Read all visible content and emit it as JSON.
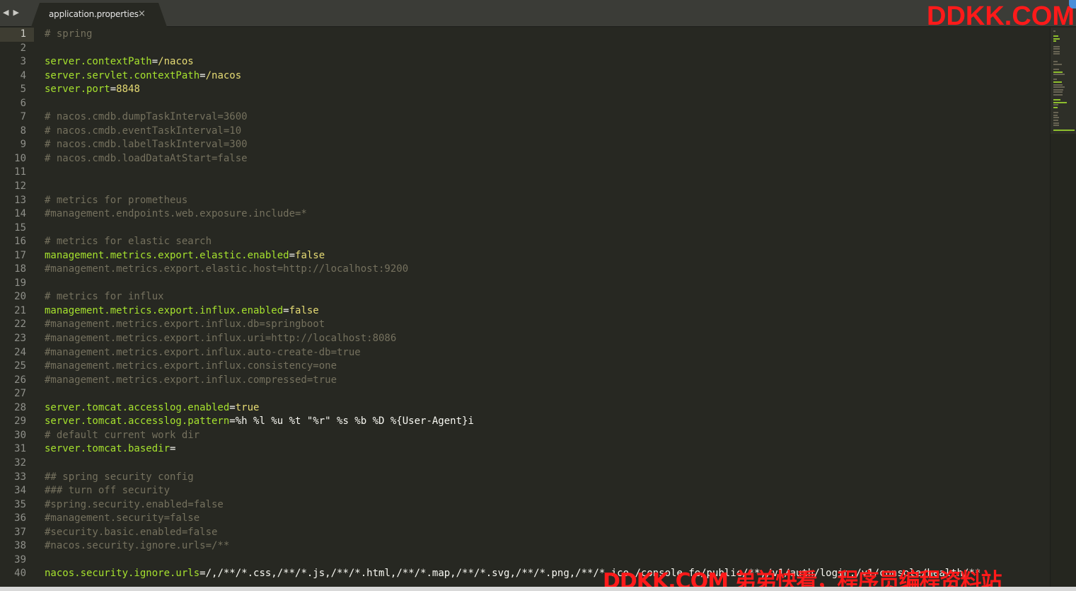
{
  "toolbar": {
    "nav_back_icon": "◀",
    "nav_forward_icon": "▶"
  },
  "tab": {
    "title": "application.properties",
    "close_icon": "×"
  },
  "watermarks": {
    "top": "DDKK.COM",
    "bottom": "DDKK.COM 弟弟快看，程序员编程资料站"
  },
  "colors": {
    "background": "#272822",
    "key": "#a6e22e",
    "value": "#e6db74",
    "comment": "#75715e",
    "text": "#f8f8f2",
    "watermark": "#ff1a1a"
  },
  "editor": {
    "active_line": 1,
    "lines": [
      {
        "n": "1",
        "type": "comment",
        "text": "# spring"
      },
      {
        "n": "2",
        "type": "blank"
      },
      {
        "n": "3",
        "type": "kv",
        "key": "server.contextPath",
        "value": "/nacos"
      },
      {
        "n": "4",
        "type": "kv",
        "key": "server.servlet.contextPath",
        "value": "/nacos"
      },
      {
        "n": "5",
        "type": "kv",
        "key": "server.port",
        "value": "8848"
      },
      {
        "n": "6",
        "type": "blank"
      },
      {
        "n": "7",
        "type": "comment",
        "text": "# nacos.cmdb.dumpTaskInterval=3600"
      },
      {
        "n": "8",
        "type": "comment",
        "text": "# nacos.cmdb.eventTaskInterval=10"
      },
      {
        "n": "9",
        "type": "comment",
        "text": "# nacos.cmdb.labelTaskInterval=300"
      },
      {
        "n": "10",
        "type": "comment",
        "text": "# nacos.cmdb.loadDataAtStart=false"
      },
      {
        "n": "11",
        "type": "blank"
      },
      {
        "n": "12",
        "type": "blank"
      },
      {
        "n": "13",
        "type": "comment",
        "text": "# metrics for prometheus"
      },
      {
        "n": "14",
        "type": "comment",
        "text": "#management.endpoints.web.exposure.include=*"
      },
      {
        "n": "15",
        "type": "blank"
      },
      {
        "n": "16",
        "type": "comment",
        "text": "# metrics for elastic search"
      },
      {
        "n": "17",
        "type": "kv",
        "key": "management.metrics.export.elastic.enabled",
        "value": "false"
      },
      {
        "n": "18",
        "type": "comment",
        "text": "#management.metrics.export.elastic.host=http://localhost:9200"
      },
      {
        "n": "19",
        "type": "blank"
      },
      {
        "n": "20",
        "type": "comment",
        "text": "# metrics for influx"
      },
      {
        "n": "21",
        "type": "kv",
        "key": "management.metrics.export.influx.enabled",
        "value": "false"
      },
      {
        "n": "22",
        "type": "comment",
        "text": "#management.metrics.export.influx.db=springboot"
      },
      {
        "n": "23",
        "type": "comment",
        "text": "#management.metrics.export.influx.uri=http://localhost:8086"
      },
      {
        "n": "24",
        "type": "comment",
        "text": "#management.metrics.export.influx.auto-create-db=true"
      },
      {
        "n": "25",
        "type": "comment",
        "text": "#management.metrics.export.influx.consistency=one"
      },
      {
        "n": "26",
        "type": "comment",
        "text": "#management.metrics.export.influx.compressed=true"
      },
      {
        "n": "27",
        "type": "blank"
      },
      {
        "n": "28",
        "type": "kv",
        "key": "server.tomcat.accesslog.enabled",
        "value": "true"
      },
      {
        "n": "29",
        "type": "kv",
        "key": "server.tomcat.accesslog.pattern",
        "value": "%h %l %u %t \"%r\" %s %b %D %{User-Agent}i",
        "plain": true
      },
      {
        "n": "30",
        "type": "comment",
        "text": "# default current work dir"
      },
      {
        "n": "31",
        "type": "kv",
        "key": "server.tomcat.basedir",
        "value": ""
      },
      {
        "n": "32",
        "type": "blank"
      },
      {
        "n": "33",
        "type": "comment",
        "text": "## spring security config"
      },
      {
        "n": "34",
        "type": "comment",
        "text": "### turn off security"
      },
      {
        "n": "35",
        "type": "comment",
        "text": "#spring.security.enabled=false"
      },
      {
        "n": "36",
        "type": "comment",
        "text": "#management.security=false"
      },
      {
        "n": "37",
        "type": "comment",
        "text": "#security.basic.enabled=false"
      },
      {
        "n": "38",
        "type": "comment",
        "text": "#nacos.security.ignore.urls=/**"
      },
      {
        "n": "39",
        "type": "blank"
      },
      {
        "n": "40",
        "type": "kv",
        "key": "nacos.security.ignore.urls",
        "value": "/,/**/*.css,/**/*.js,/**/*.html,/**/*.map,/**/*.svg,/**/*.png,/**/*.ico,/console-fe/public/**,/v1/auth/login,/v1/console/health/**",
        "plain": true
      }
    ]
  }
}
